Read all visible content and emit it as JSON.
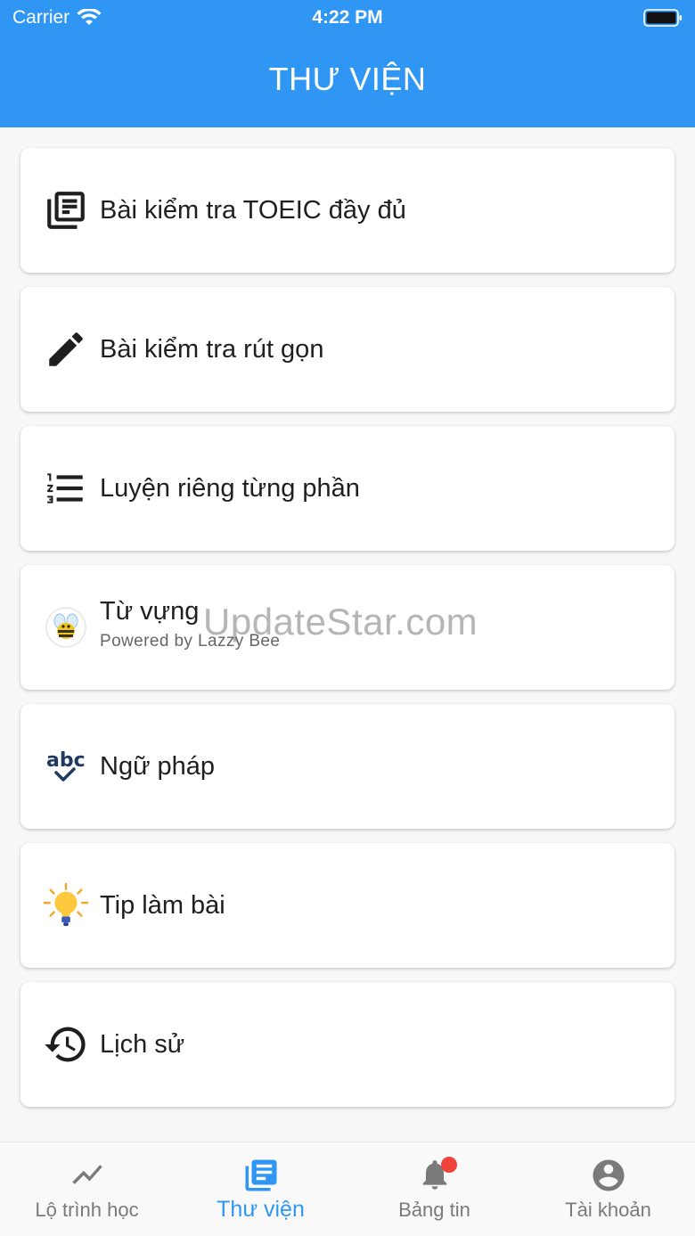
{
  "status": {
    "carrier": "Carrier",
    "time": "4:22 PM"
  },
  "header": {
    "title": "THƯ VIỆN",
    "color": "#2f96f3"
  },
  "menu": [
    {
      "label": "Bài kiểm tra TOEIC đầy đủ",
      "icon": "newspaper-icon"
    },
    {
      "label": "Bài kiểm tra rút gọn",
      "icon": "pencil-icon"
    },
    {
      "label": "Luyện riêng từng phần",
      "icon": "numbered-list-icon"
    },
    {
      "label": "Từ vựng",
      "sublabel": "Powered by Lazzy Bee",
      "icon": "bee-icon"
    },
    {
      "label": "Ngữ pháp",
      "icon": "spellcheck-icon"
    },
    {
      "label": "Tip làm bài",
      "icon": "lightbulb-icon"
    },
    {
      "label": "Lịch sử",
      "icon": "history-icon"
    }
  ],
  "watermark": "UpdateStar.com",
  "tabs": [
    {
      "label": "Lộ trình học",
      "icon": "trending-icon",
      "active": false
    },
    {
      "label": "Thư viện",
      "icon": "library-icon",
      "active": true
    },
    {
      "label": "Bảng tin",
      "icon": "bell-icon",
      "active": false,
      "badge": true
    },
    {
      "label": "Tài khoản",
      "icon": "account-icon",
      "active": false
    }
  ]
}
